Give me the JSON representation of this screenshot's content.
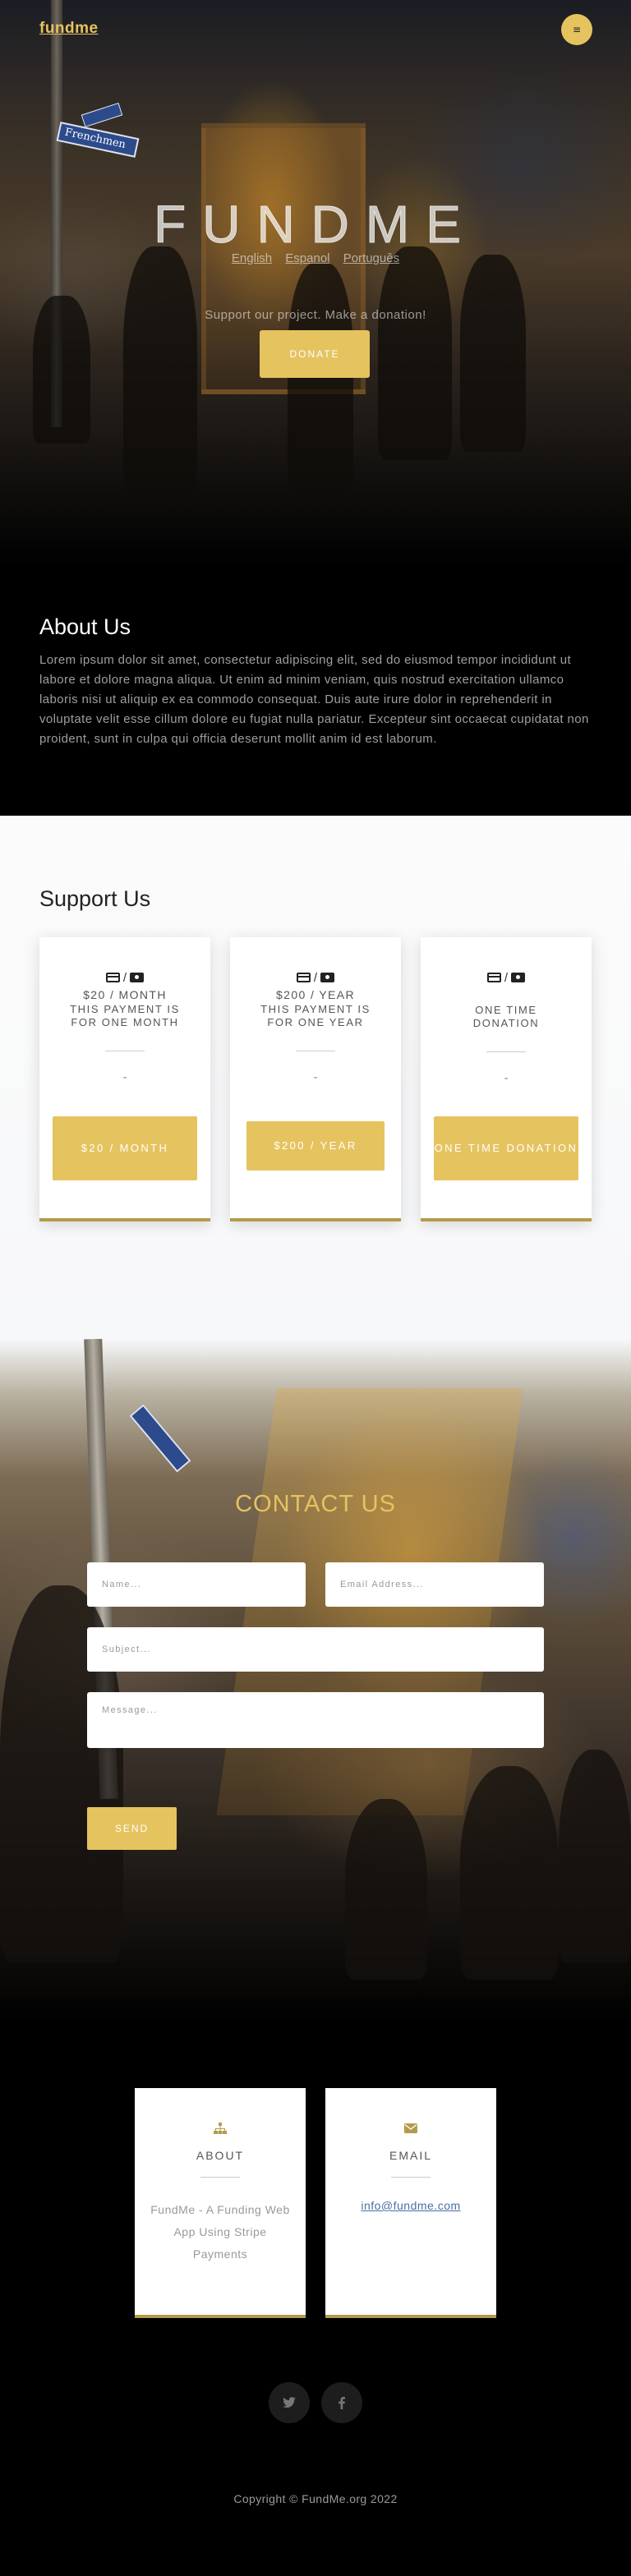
{
  "header": {
    "brand": "fundme",
    "menu_icon": "menu-icon"
  },
  "hero": {
    "title": "FUNDME",
    "languages": [
      "English",
      "Espanol",
      "Português"
    ],
    "tagline": "Support our project. Make a donation!",
    "donate_label": "DONATE",
    "street_sign": "Frenchmen"
  },
  "about": {
    "heading": "About Us",
    "body": "Lorem ipsum dolor sit amet, consectetur adipiscing elit, sed do eiusmod tempor incididunt ut labore et dolore magna aliqua. Ut enim ad minim veniam, quis nostrud exercitation ullamco laboris nisi ut aliquip ex ea commodo consequat. Duis aute irure dolor in reprehenderit in voluptate velit esse cillum dolore eu fugiat nulla pariatur. Excepteur sint occaecat cupidatat non proident, sunt in culpa qui officia deserunt mollit anim id est laborum."
  },
  "support": {
    "heading": "Support Us",
    "cards": [
      {
        "icons": [
          "credit-card-icon",
          "money-bill-icon"
        ],
        "separator": "/",
        "price": "$20 / MONTH",
        "description": "THIS PAYMENT IS FOR ONE MONTH",
        "dash": "-",
        "button": "$20 / MONTH"
      },
      {
        "icons": [
          "credit-card-icon",
          "money-bill-icon"
        ],
        "separator": "/",
        "price": "$200 / YEAR",
        "description": "THIS PAYMENT IS FOR ONE YEAR",
        "dash": "-",
        "button": "$200 / YEAR"
      },
      {
        "icons": [
          "credit-card-icon",
          "money-bill-icon"
        ],
        "separator": "/",
        "price": "",
        "description": "ONE TIME DONATION",
        "dash": "-",
        "button": "ONE TIME DONATION"
      }
    ]
  },
  "contact": {
    "heading": "CONTACT US",
    "name_placeholder": "Name...",
    "email_placeholder": "Email Address...",
    "subject_placeholder": "Subject...",
    "message_placeholder": "Message...",
    "send_label": "SEND"
  },
  "info": {
    "about": {
      "icon": "sitemap-icon",
      "title": "ABOUT",
      "text": "FundMe - A Funding Web App Using Stripe Payments"
    },
    "email": {
      "icon": "envelope-icon",
      "title": "EMAIL",
      "link": "info@fundme.com"
    }
  },
  "social": [
    "twitter-icon",
    "facebook-icon"
  ],
  "footer": {
    "copyright": "Copyright © FundMe.org 2022"
  },
  "colors": {
    "accent": "#e5c35f",
    "card_border": "#b39b4b",
    "link": "#4a6fa5"
  }
}
